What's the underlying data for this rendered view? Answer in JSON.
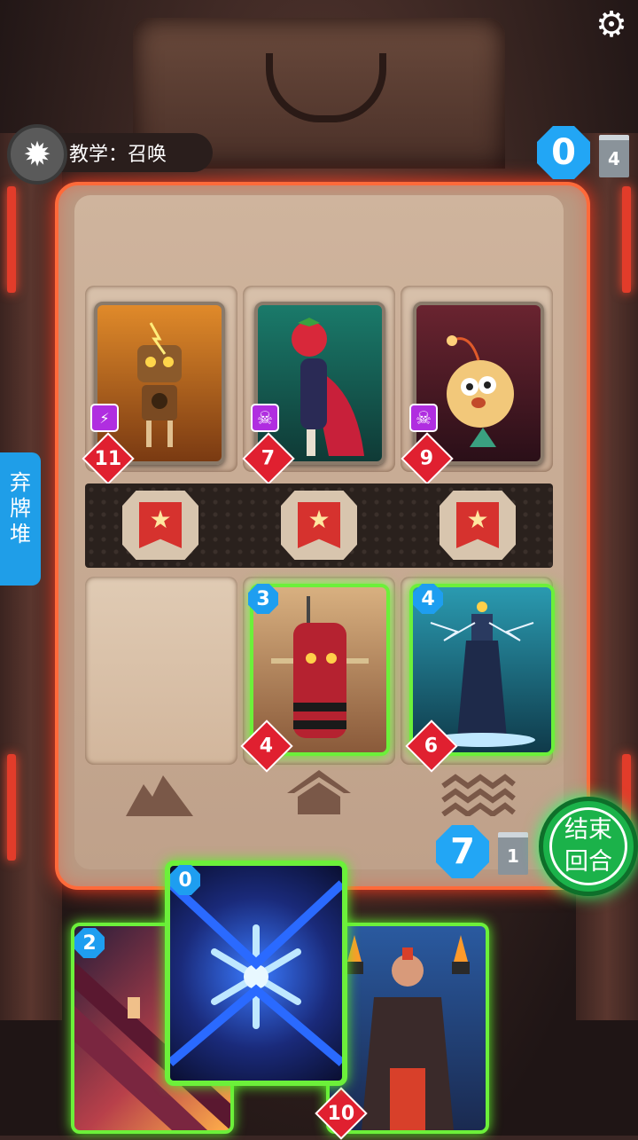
{
  "hud": {
    "settings_icon": "gear-icon",
    "tutorial_title": "教学：召唤",
    "opponent_energy": "0",
    "opponent_deck_count": "4",
    "player_energy": "7",
    "player_deck_count": "1",
    "discard_label": "弃\n牌\n堆",
    "end_turn_label": "结束\n回合"
  },
  "enemy_cards": [
    {
      "name": "electric-robot",
      "power": "11",
      "ability_icon": "lightning-bolt-icon"
    },
    {
      "name": "tomato-hero",
      "power": "7",
      "ability_icon": "skull-icon"
    },
    {
      "name": "pufferfish",
      "power": "9",
      "ability_icon": "skull-icon"
    }
  ],
  "player_board_cards": [
    {
      "name": "punching-bag",
      "cost": "3",
      "power": "4"
    },
    {
      "name": "tesla-tower",
      "cost": "4",
      "power": "6"
    }
  ],
  "hand_cards": [
    {
      "name": "stairs-card",
      "cost": "2"
    },
    {
      "name": "snowflake-card",
      "cost": "0"
    },
    {
      "name": "fire-warrior-card",
      "power": "10"
    }
  ],
  "lane_icons": [
    "mountain-icon",
    "house-icon",
    "waves-icon"
  ],
  "colors": {
    "energy": "#22a6f5",
    "power": "#e02030",
    "board_glow": "#ff6a3a",
    "playable": "#6cf03a",
    "end_turn": "#1bb24a"
  }
}
